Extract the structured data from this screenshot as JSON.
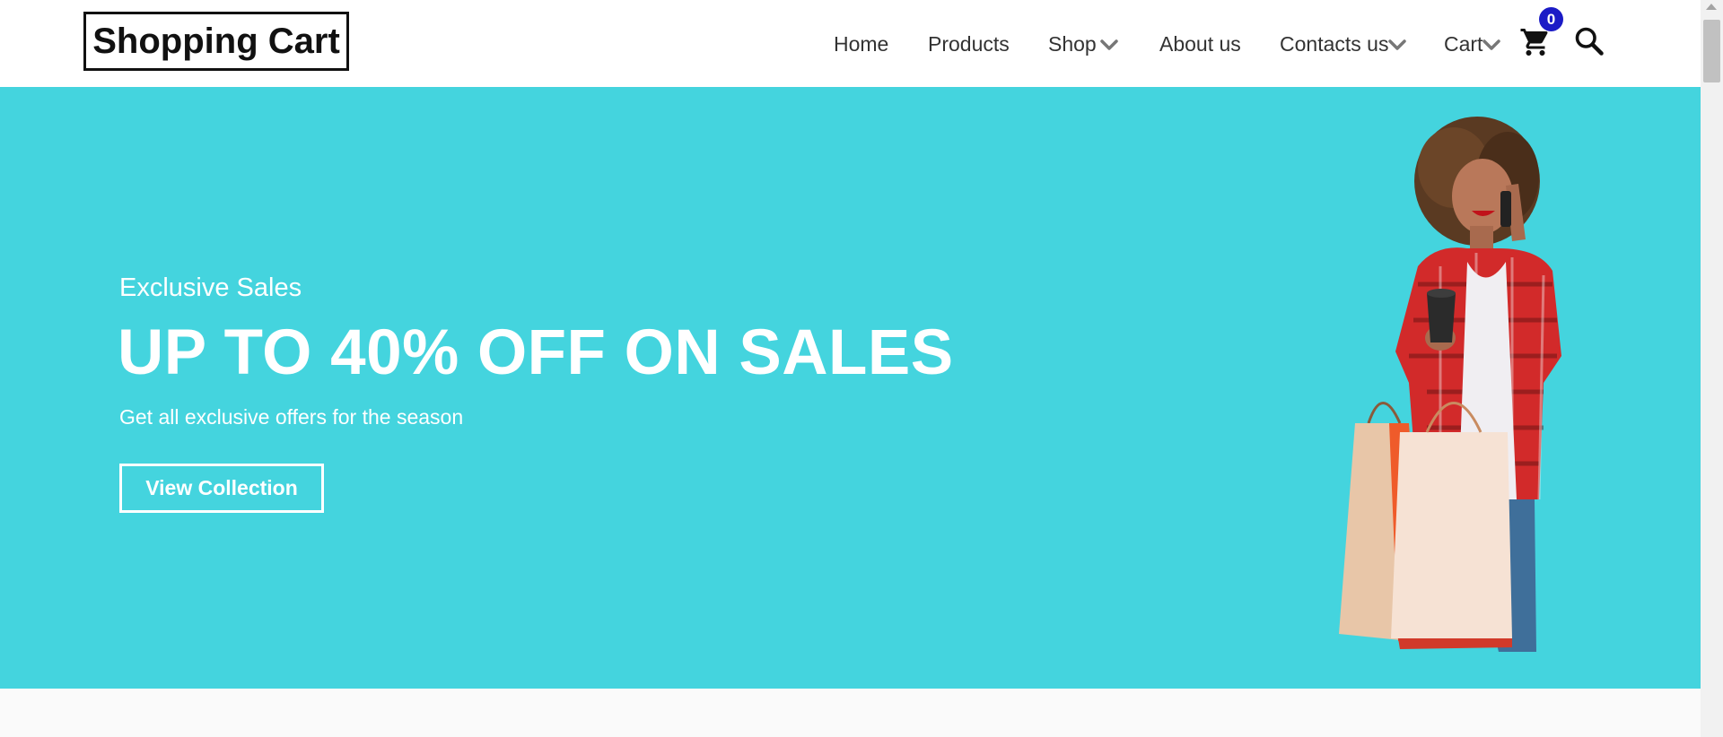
{
  "brand": {
    "logo_text": "Shopping Cart"
  },
  "nav": {
    "items": [
      {
        "label": "Home",
        "has_dropdown": false
      },
      {
        "label": "Products",
        "has_dropdown": false
      },
      {
        "label": "Shop",
        "has_dropdown": true
      },
      {
        "label": "About us",
        "has_dropdown": false
      },
      {
        "label": "Contacts us",
        "has_dropdown": true
      },
      {
        "label": "Cart",
        "has_dropdown": true
      }
    ],
    "cart_count": "0",
    "icons": {
      "cart": "cart-icon",
      "search": "search-icon",
      "dropdown": "chevron-down-icon"
    }
  },
  "hero": {
    "kicker": "Exclusive Sales",
    "title": "UP TO 40% OFF ON SALES",
    "subtitle": "Get all exclusive offers for the season",
    "cta_label": "View Collection",
    "background_color": "#44d4de",
    "image": "woman-with-shopping-bags"
  },
  "colors": {
    "badge": "#1b1bc6",
    "text": "#333333",
    "hero_text": "#ffffff"
  }
}
